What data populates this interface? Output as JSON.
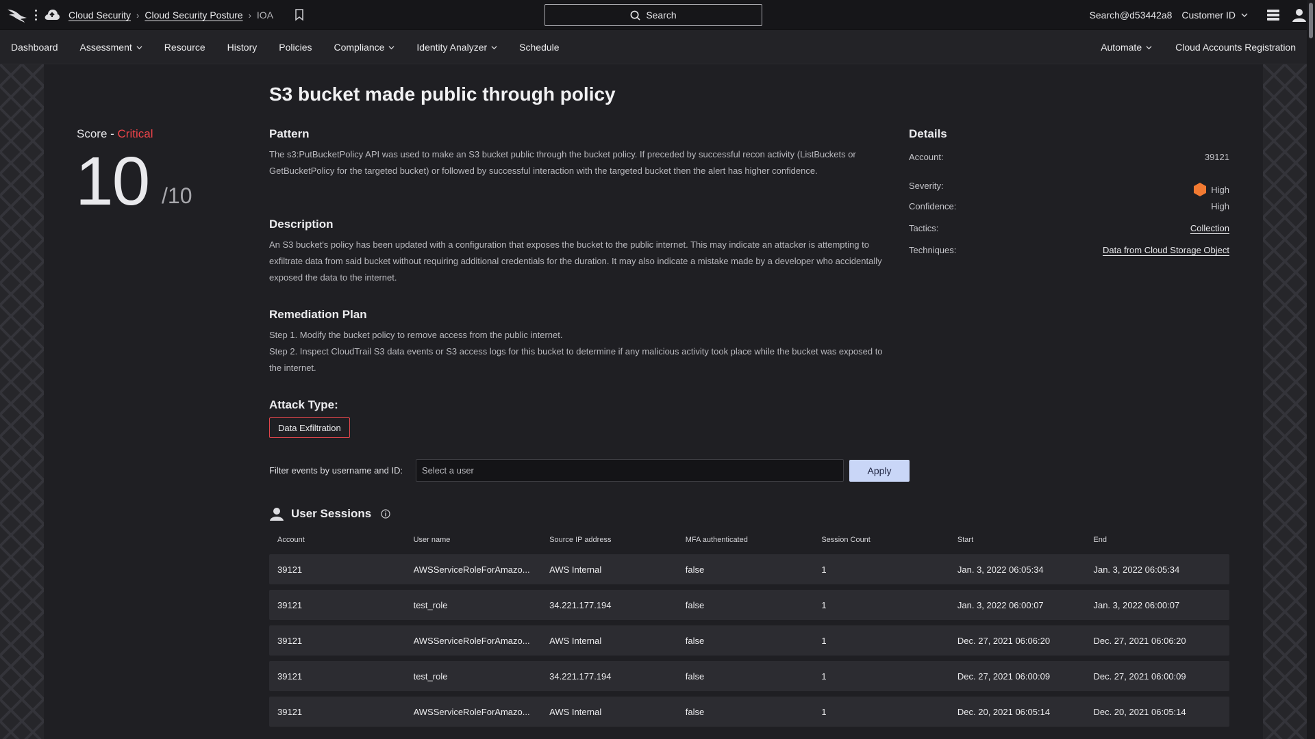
{
  "topbar": {
    "breadcrumbs": [
      "Cloud Security",
      "Cloud Security Posture",
      "IOA"
    ],
    "search_label": "Search",
    "user": "Search@d53442a8",
    "customer_label": "Customer ID"
  },
  "nav": {
    "left": [
      {
        "label": "Dashboard",
        "dropdown": false
      },
      {
        "label": "Assessment",
        "dropdown": true
      },
      {
        "label": "Resource",
        "dropdown": false
      },
      {
        "label": "History",
        "dropdown": false
      },
      {
        "label": "Policies",
        "dropdown": false
      },
      {
        "label": "Compliance",
        "dropdown": true
      },
      {
        "label": "Identity Analyzer",
        "dropdown": true
      },
      {
        "label": "Schedule",
        "dropdown": false
      }
    ],
    "right": [
      {
        "label": "Automate",
        "dropdown": true
      },
      {
        "label": "Cloud Accounts Registration",
        "dropdown": false
      }
    ]
  },
  "score": {
    "label": "Score - ",
    "severity": "Critical",
    "value": "10",
    "max": "/10"
  },
  "title": "S3 bucket made public through policy",
  "pattern": {
    "heading": "Pattern",
    "text": "The s3:PutBucketPolicy API was used to make an S3 bucket public through the bucket policy. If preceded by successful recon activity (ListBuckets or GetBucketPolicy for the targeted bucket) or followed by successful interaction with the targeted bucket then the alert has higher confidence."
  },
  "description": {
    "heading": "Description",
    "text": "An S3 bucket's policy has been updated with a configuration that exposes the bucket to the public internet. This may indicate an attacker is attempting to exfiltrate data from said bucket without requiring additional credentials for the duration. It may also indicate a mistake made by a developer who accidentally exposed the data to the internet."
  },
  "remediation": {
    "heading": "Remediation Plan",
    "step1": "Step 1. Modify the bucket policy to remove access from the public internet.",
    "step2": "Step 2. Inspect CloudTrail S3 data events or S3 access logs for this bucket to determine if any malicious activity took place while the bucket was exposed to the internet."
  },
  "attack": {
    "heading": "Attack Type:",
    "type": "Data Exfiltration"
  },
  "filter": {
    "label": "Filter events by username and ID:",
    "placeholder": "Select a user",
    "apply": "Apply"
  },
  "sessions": {
    "heading": "User Sessions",
    "columns": [
      "Account",
      "User name",
      "Source IP address",
      "MFA authenticated",
      "Session Count",
      "Start",
      "End"
    ],
    "rows": [
      [
        "39121",
        "AWSServiceRoleForAmazo...",
        "AWS Internal",
        "false",
        "1",
        "Jan. 3, 2022 06:05:34",
        "Jan. 3, 2022 06:05:34"
      ],
      [
        "39121",
        "test_role",
        "34.221.177.194",
        "false",
        "1",
        "Jan. 3, 2022 06:00:07",
        "Jan. 3, 2022 06:00:07"
      ],
      [
        "39121",
        "AWSServiceRoleForAmazo...",
        "AWS Internal",
        "false",
        "1",
        "Dec. 27, 2021 06:06:20",
        "Dec. 27, 2021 06:06:20"
      ],
      [
        "39121",
        "test_role",
        "34.221.177.194",
        "false",
        "1",
        "Dec. 27, 2021 06:00:09",
        "Dec. 27, 2021 06:00:09"
      ],
      [
        "39121",
        "AWSServiceRoleForAmazo...",
        "AWS Internal",
        "false",
        "1",
        "Dec. 20, 2021 06:05:14",
        "Dec. 20, 2021 06:05:14"
      ]
    ]
  },
  "details": {
    "heading": "Details",
    "account_label": "Account:",
    "account": "39121",
    "severity_label": "Severity:",
    "severity": "High",
    "confidence_label": "Confidence:",
    "confidence": "High",
    "tactics_label": "Tactics:",
    "tactics": "Collection",
    "techniques_label": "Techniques:",
    "techniques": "Data from Cloud Storage Object"
  },
  "colors": {
    "critical": "#f0444a",
    "severity_high": "#f27a32",
    "apply_button": "#c9d6f7"
  }
}
